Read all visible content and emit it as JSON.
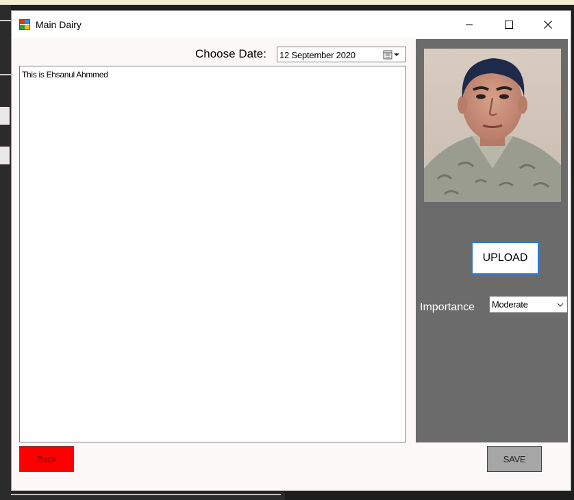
{
  "window": {
    "title": "Main Dairy"
  },
  "date_picker": {
    "label": "Choose Date:",
    "value": "12 September 2020"
  },
  "diary": {
    "text": "This is Ehsanul Ahmmed"
  },
  "side_panel": {
    "upload_label": "UPLOAD",
    "importance_label": "Importance",
    "importance_value": "Moderate"
  },
  "buttons": {
    "back_label": "Back",
    "save_label": "SAVE"
  },
  "colors": {
    "side_panel_bg": "#6b6b6b",
    "back_button_bg": "#ff0000",
    "save_button_bg": "#a6a6a6",
    "upload_border": "#2a7ad4"
  },
  "icons": {
    "app": "app-window-icon",
    "minimize": "minimize-icon",
    "maximize": "maximize-icon",
    "close": "close-icon",
    "calendar": "calendar-icon",
    "dropdown": "chevron-down-icon"
  }
}
